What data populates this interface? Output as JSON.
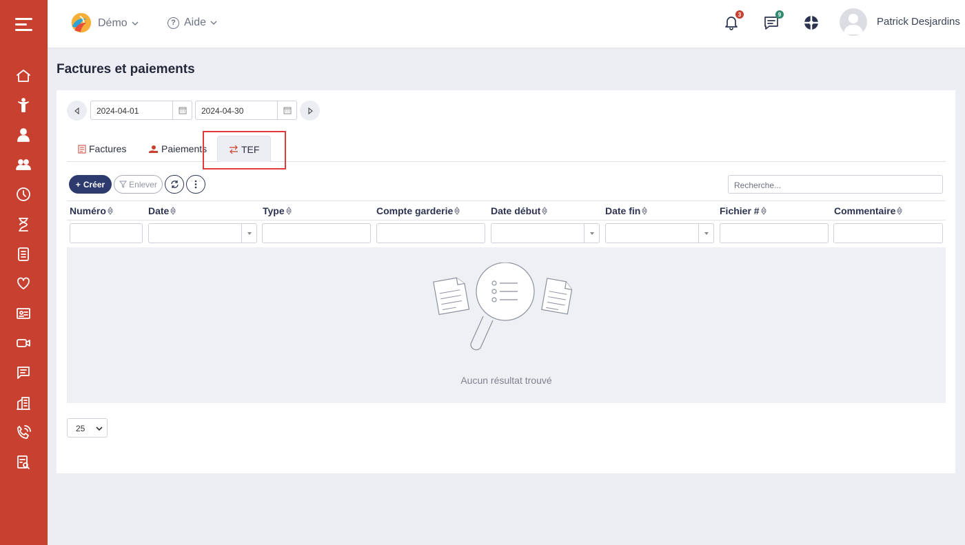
{
  "topbar": {
    "org_name": "Démo",
    "help_label": "Aide",
    "notifications_count": "3",
    "messages_count": "9",
    "user_name": "Patrick Desjardins",
    "colors": {
      "notif_badge": "#c8402f",
      "msg_badge": "#2e8b6f"
    }
  },
  "sidebar": {
    "items": [
      "home-icon",
      "child-icon",
      "educator-icon",
      "group-icon",
      "clock-icon",
      "hourglass-icon",
      "document-list-icon",
      "heart-icon",
      "id-card-icon",
      "video-icon",
      "chat-icon",
      "building-icon",
      "phone-icon",
      "report-icon"
    ],
    "color": "#c8402f"
  },
  "page": {
    "title": "Factures et paiements"
  },
  "date_range": {
    "start": "2024-04-01",
    "end": "2024-04-30"
  },
  "tabs": [
    {
      "label": "Factures",
      "icon": "invoice-icon"
    },
    {
      "label": "Paiements",
      "icon": "payment-icon"
    },
    {
      "label": "TEF",
      "icon": "transfer-icon",
      "active": true
    }
  ],
  "toolbar": {
    "create_label": "Créer",
    "remove_label": "Enlever",
    "search_placeholder": "Recherche..."
  },
  "table": {
    "columns": [
      "Numéro",
      "Date",
      "Type",
      "Compte garderie",
      "Date début",
      "Date fin",
      "Fichier #",
      "Commentaire"
    ],
    "empty_message": "Aucun résultat trouvé",
    "page_size": "25"
  }
}
